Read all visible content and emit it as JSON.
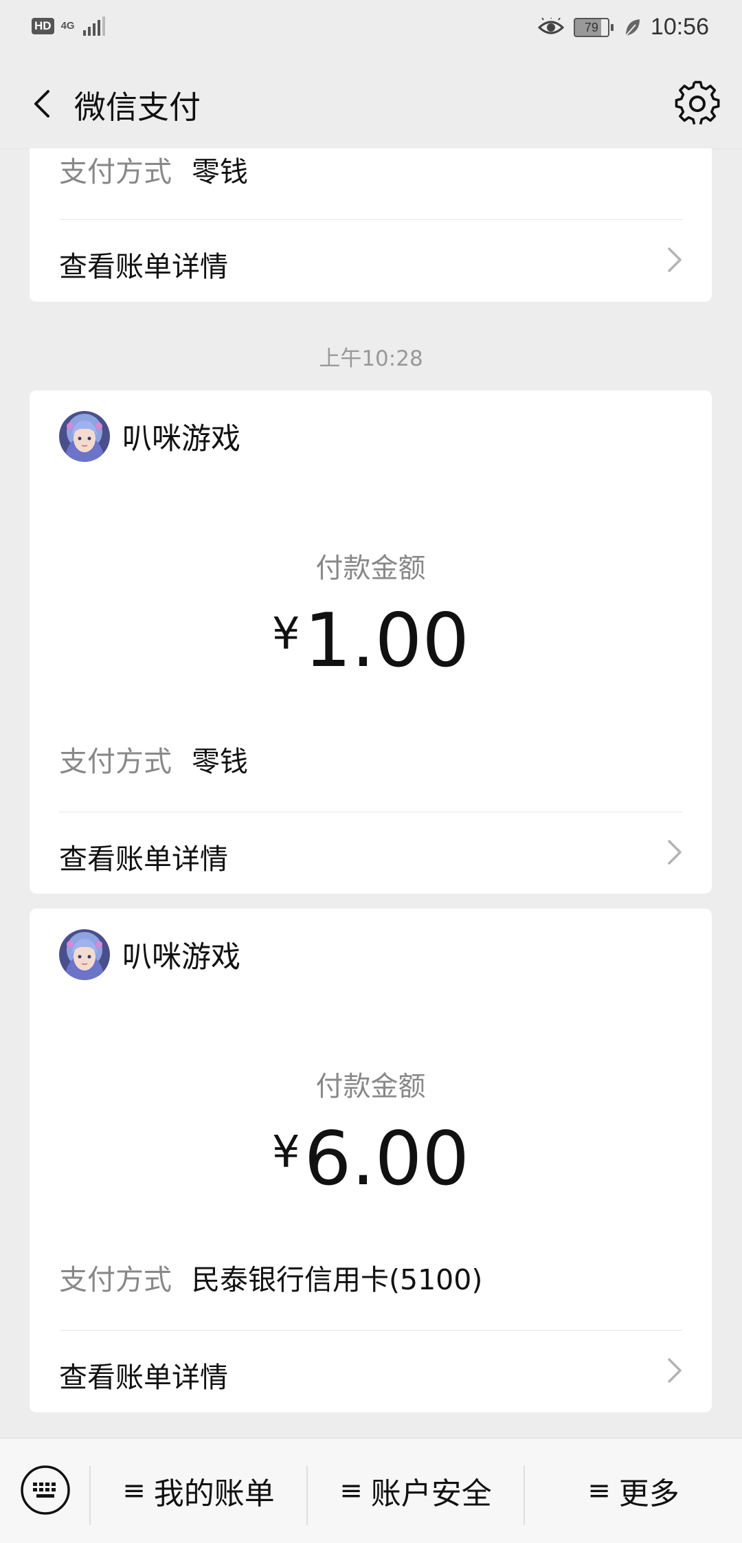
{
  "status_bar": {
    "hd": "HD",
    "network": "4G",
    "battery": "79",
    "time": "10:56"
  },
  "header": {
    "title": "微信支付"
  },
  "partial_card": {
    "pay_method_label": "支付方式",
    "pay_method_value": "零钱",
    "detail_label": "查看账单详情"
  },
  "timestamp": "上午10:28",
  "payments": [
    {
      "merchant": "叭咪游戏",
      "amount_label": "付款金额",
      "currency": "¥",
      "amount": "1.00",
      "pay_method_label": "支付方式",
      "pay_method_value": "零钱",
      "detail_label": "查看账单详情"
    },
    {
      "merchant": "叭咪游戏",
      "amount_label": "付款金额",
      "currency": "¥",
      "amount": "6.00",
      "pay_method_label": "支付方式",
      "pay_method_value": "民泰银行信用卡(5100)",
      "detail_label": "查看账单详情"
    }
  ],
  "bottom_menu": {
    "icon": "keyboard-icon",
    "items": [
      {
        "label": "我的账单"
      },
      {
        "label": "账户安全"
      },
      {
        "label": "更多"
      }
    ]
  }
}
